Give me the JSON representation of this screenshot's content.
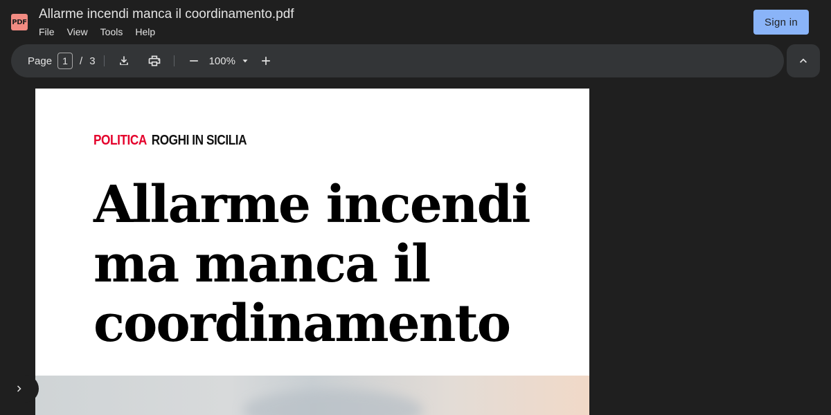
{
  "app": {
    "logo_text": "PDF",
    "title": "Allarme incendi manca il coordinamento.pdf"
  },
  "menu": {
    "items": [
      "File",
      "View",
      "Tools",
      "Help"
    ]
  },
  "header": {
    "sign_in_label": "Sign in"
  },
  "toolbar": {
    "page_label": "Page",
    "current_page": "1",
    "separator": "/",
    "total_pages": "3",
    "zoom": "100%",
    "icons": [
      "download-icon",
      "print-icon",
      "zoom-out-icon",
      "dropdown-arrow-icon",
      "zoom-in-icon",
      "chevron-up-icon"
    ]
  },
  "document": {
    "kicker_section": "POLITICA",
    "kicker_topic": "ROGHI IN SICILIA",
    "headline": "Allarme incendi ma manca il coordinamento",
    "colors": {
      "section": "#e4002b",
      "headline": "#000000"
    }
  },
  "sidebar": {
    "toggle_icon": "chevron-right-icon"
  },
  "theme": {
    "background": "#1f1f1f",
    "toolbar": "#333537",
    "accent": "#8ab4f8"
  }
}
